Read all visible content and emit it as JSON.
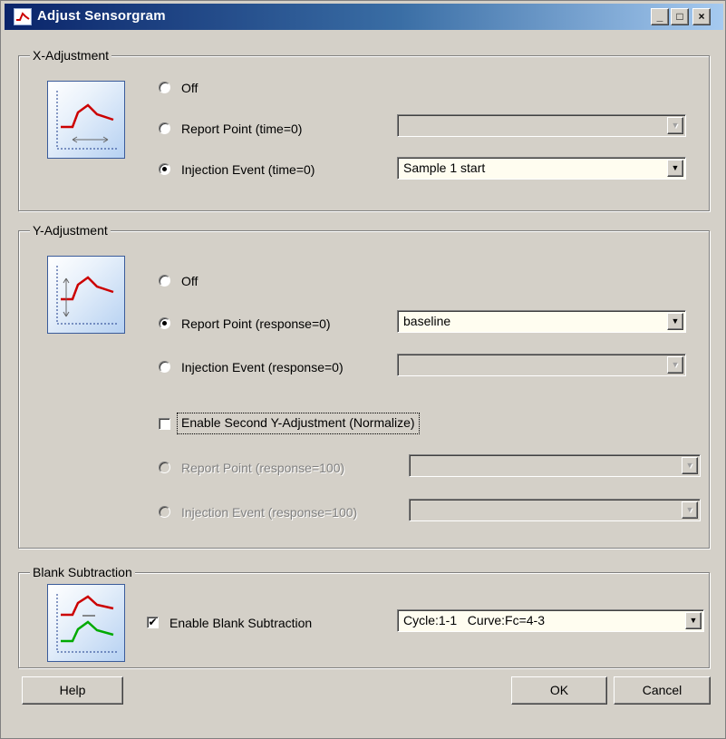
{
  "window": {
    "title": "Adjust Sensorgram",
    "controls": {
      "minimize": "_",
      "maximize": "□",
      "close": "×"
    }
  },
  "x_adjustment": {
    "legend": "X-Adjustment",
    "icon": "sensorgram-x-adjustment-icon",
    "options": [
      {
        "label": "Off",
        "selected": false
      },
      {
        "label": "Report Point (time=0)",
        "selected": false
      },
      {
        "label": "Injection Event (time=0)",
        "selected": true
      }
    ],
    "report_point_value": "",
    "injection_event_value": "Sample 1 start"
  },
  "y_adjustment": {
    "legend": "Y-Adjustment",
    "icon": "sensorgram-y-adjustment-icon",
    "options": [
      {
        "label": "Off",
        "selected": false
      },
      {
        "label": "Report Point  (response=0)",
        "selected": true
      },
      {
        "label": "Injection Event  (response=0)",
        "selected": false
      }
    ],
    "report_point_value": "baseline",
    "injection_event_value": "",
    "second_adjustment": {
      "label": "Enable Second Y-Adjustment (Normalize)",
      "checked": false,
      "options": [
        {
          "label": "Report Point  (response=100)",
          "selected": false
        },
        {
          "label": "Injection Event  (response=100)",
          "selected": false
        }
      ],
      "report_point_value": "",
      "injection_event_value": ""
    }
  },
  "blank_subtraction": {
    "legend": "Blank Subtraction",
    "icon": "sensorgram-blank-subtraction-icon",
    "checkbox_label": "Enable Blank Subtraction",
    "checked": true,
    "curve_value": "Cycle:1-1   Curve:Fc=4-3"
  },
  "buttons": {
    "help": "Help",
    "ok": "OK",
    "cancel": "Cancel"
  },
  "glyphs": {
    "dropdown_arrow": "▼",
    "check_mark": "✔"
  },
  "colors": {
    "title_gradient_start": "#0a246a",
    "title_gradient_end": "#a6caf0",
    "dialog_background": "#d4d0c8",
    "curve_red": "#cc0000",
    "curve_green": "#00aa00"
  }
}
